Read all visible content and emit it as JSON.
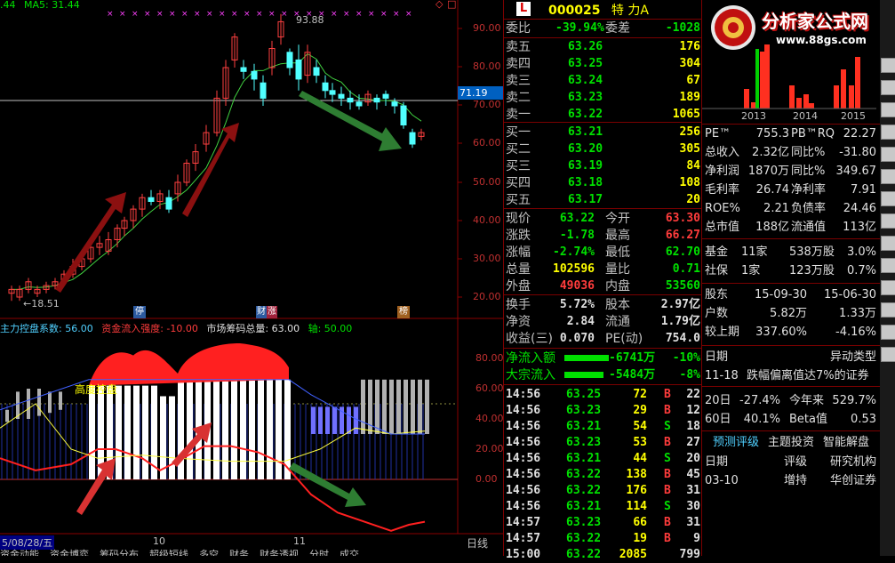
{
  "chart": {
    "ma_header": {
      "prefix": ".44",
      "ma5_label": "MA5: 31.44"
    },
    "price_axis": [
      "90.00",
      "80.00",
      "70.00",
      "60.00",
      "50.00",
      "40.00",
      "30.00",
      "20.00"
    ],
    "current_price_tag": "71.19",
    "high_annotation": "93.88",
    "low_annotation": "←18.51",
    "event_labels": [
      "停",
      "财",
      "涨",
      "榜"
    ],
    "indicator_header": {
      "a": "主力控盘系数: 56.00",
      "b": "资金流入强度: -10.00",
      "c": "市场筹码总量: 63.00",
      "d": "轴: 50.00"
    },
    "indicator_axis": [
      "80.00",
      "60.00",
      "40.00",
      "20.00",
      "0.00"
    ],
    "indicator_label": "高度控盘",
    "date_axis": {
      "start": "5/08/28/五",
      "m10": "10",
      "m11": "11",
      "period": "日线"
    },
    "bottom_tabs": [
      "资金动能",
      "资金博弈",
      "筹码分布",
      "超级短线",
      "多空",
      "财务",
      "财务透视",
      "分时",
      "成交"
    ]
  },
  "quote": {
    "logo_letter": "L",
    "code": "000025",
    "name": "特 力A",
    "weibi_label": "委比",
    "weibi_value": "-39.94%",
    "weicha_label": "委差",
    "weicha_value": "-1028",
    "asks": [
      {
        "label": "卖五",
        "price": "63.26",
        "vol": "176"
      },
      {
        "label": "卖四",
        "price": "63.25",
        "vol": "304"
      },
      {
        "label": "卖三",
        "price": "63.24",
        "vol": "67"
      },
      {
        "label": "卖二",
        "price": "63.23",
        "vol": "189"
      },
      {
        "label": "卖一",
        "price": "63.22",
        "vol": "1065"
      }
    ],
    "bids": [
      {
        "label": "买一",
        "price": "63.21",
        "vol": "256"
      },
      {
        "label": "买二",
        "price": "63.20",
        "vol": "305"
      },
      {
        "label": "买三",
        "price": "63.19",
        "vol": "84"
      },
      {
        "label": "买四",
        "price": "63.18",
        "vol": "108"
      },
      {
        "label": "买五",
        "price": "63.17",
        "vol": "20"
      }
    ],
    "stats": [
      {
        "l1": "现价",
        "v1": "63.22",
        "l2": "今开",
        "v2": "63.30",
        "c1": "grn",
        "c2": "red"
      },
      {
        "l1": "涨跌",
        "v1": "-1.78",
        "l2": "最高",
        "v2": "66.27",
        "c1": "grn",
        "c2": "red"
      },
      {
        "l1": "涨幅",
        "v1": "-2.74%",
        "l2": "最低",
        "v2": "62.70",
        "c1": "grn",
        "c2": "grn"
      },
      {
        "l1": "总量",
        "v1": "102596",
        "l2": "量比",
        "v2": "0.71",
        "c1": "yel",
        "c2": "grn"
      },
      {
        "l1": "外盘",
        "v1": "49036",
        "l2": "内盘",
        "v2": "53560",
        "c1": "red",
        "c2": "grn"
      }
    ],
    "stats2": [
      {
        "l1": "换手",
        "v1": "5.72%",
        "l2": "股本",
        "v2": "2.97亿"
      },
      {
        "l1": "净资",
        "v1": "2.84",
        "l2": "流通",
        "v2": "1.79亿"
      },
      {
        "l1": "收益(三)",
        "v1": "0.070",
        "l2": "PE(动)",
        "v2": "754.0"
      }
    ],
    "flow": [
      {
        "label": "净流入额",
        "value": "-6741万",
        "pct": "-10%"
      },
      {
        "label": "大宗流入",
        "value": "-5484万",
        "pct": "-8%"
      }
    ],
    "ticks": [
      {
        "t": "14:56",
        "p": "63.25",
        "v": "72",
        "bs": "B",
        "n": "22"
      },
      {
        "t": "14:56",
        "p": "63.23",
        "v": "29",
        "bs": "B",
        "n": "12"
      },
      {
        "t": "14:56",
        "p": "63.21",
        "v": "54",
        "bs": "S",
        "n": "18"
      },
      {
        "t": "14:56",
        "p": "63.23",
        "v": "53",
        "bs": "B",
        "n": "27"
      },
      {
        "t": "14:56",
        "p": "63.21",
        "v": "44",
        "bs": "S",
        "n": "20"
      },
      {
        "t": "14:56",
        "p": "63.22",
        "v": "138",
        "bs": "B",
        "n": "45"
      },
      {
        "t": "14:56",
        "p": "63.22",
        "v": "176",
        "bs": "B",
        "n": "31"
      },
      {
        "t": "14:56",
        "p": "63.21",
        "v": "114",
        "bs": "S",
        "n": "30"
      },
      {
        "t": "14:57",
        "p": "63.23",
        "v": "66",
        "bs": "B",
        "n": "31"
      },
      {
        "t": "14:57",
        "p": "63.22",
        "v": "19",
        "bs": "B",
        "n": "9"
      },
      {
        "t": "15:00",
        "p": "63.22",
        "v": "2085",
        "bs": "",
        "n": "799"
      }
    ]
  },
  "info": {
    "logo_text": "分析家公式网",
    "logo_url": "www.88gs.com",
    "bar_years": [
      "2013",
      "2014",
      "2015"
    ],
    "rows": [
      {
        "a": "PE™",
        "b": "755.3",
        "c": "PB™RQ",
        "d": "22.27"
      },
      {
        "a": "总收入",
        "b": "2.32亿",
        "c": "同比%",
        "d": "-31.80"
      },
      {
        "a": "净利润",
        "b": "1870万",
        "c": "同比%",
        "d": "349.67"
      },
      {
        "a": "毛利率",
        "b": "26.74",
        "c": "净利率",
        "d": "7.91"
      },
      {
        "a": "ROE%",
        "b": "2.21",
        "c": "负债率",
        "d": "24.46"
      },
      {
        "a": "总市值",
        "b": "188亿",
        "c": "流通值",
        "d": "113亿"
      }
    ],
    "funds": [
      {
        "a": "基金",
        "b": "11家",
        "c": "538万股",
        "d": "3.0%"
      },
      {
        "a": "社保",
        "b": "1家",
        "c": "123万股",
        "d": "0.7%"
      }
    ],
    "holders": {
      "label": "股东",
      "d1": "15-09-30",
      "d2": "15-06-30",
      "hu_label": "户数",
      "hu1": "5.82万",
      "hu2": "1.33万",
      "cmp_label": "较上期",
      "c1": "337.60%",
      "c2": "-4.16%"
    },
    "anomaly": {
      "h1": "日期",
      "h2": "异动类型",
      "date": "11-18",
      "desc": "跌幅偏离值达7%的证券"
    },
    "beta": {
      "r1a": "20日",
      "r1b": "-27.4%",
      "r1c": "今年来",
      "r1d": "529.7%",
      "r2a": "60日",
      "r2b": "40.1%",
      "r2c": "Beta值",
      "r2d": "0.53"
    },
    "tabs": [
      "预测评级",
      "主题投资",
      "智能解盘"
    ],
    "rating": {
      "h1": "日期",
      "h2": "评级",
      "h3": "研究机构",
      "d": "03-10",
      "r": "增持",
      "org": "华创证券"
    }
  }
}
